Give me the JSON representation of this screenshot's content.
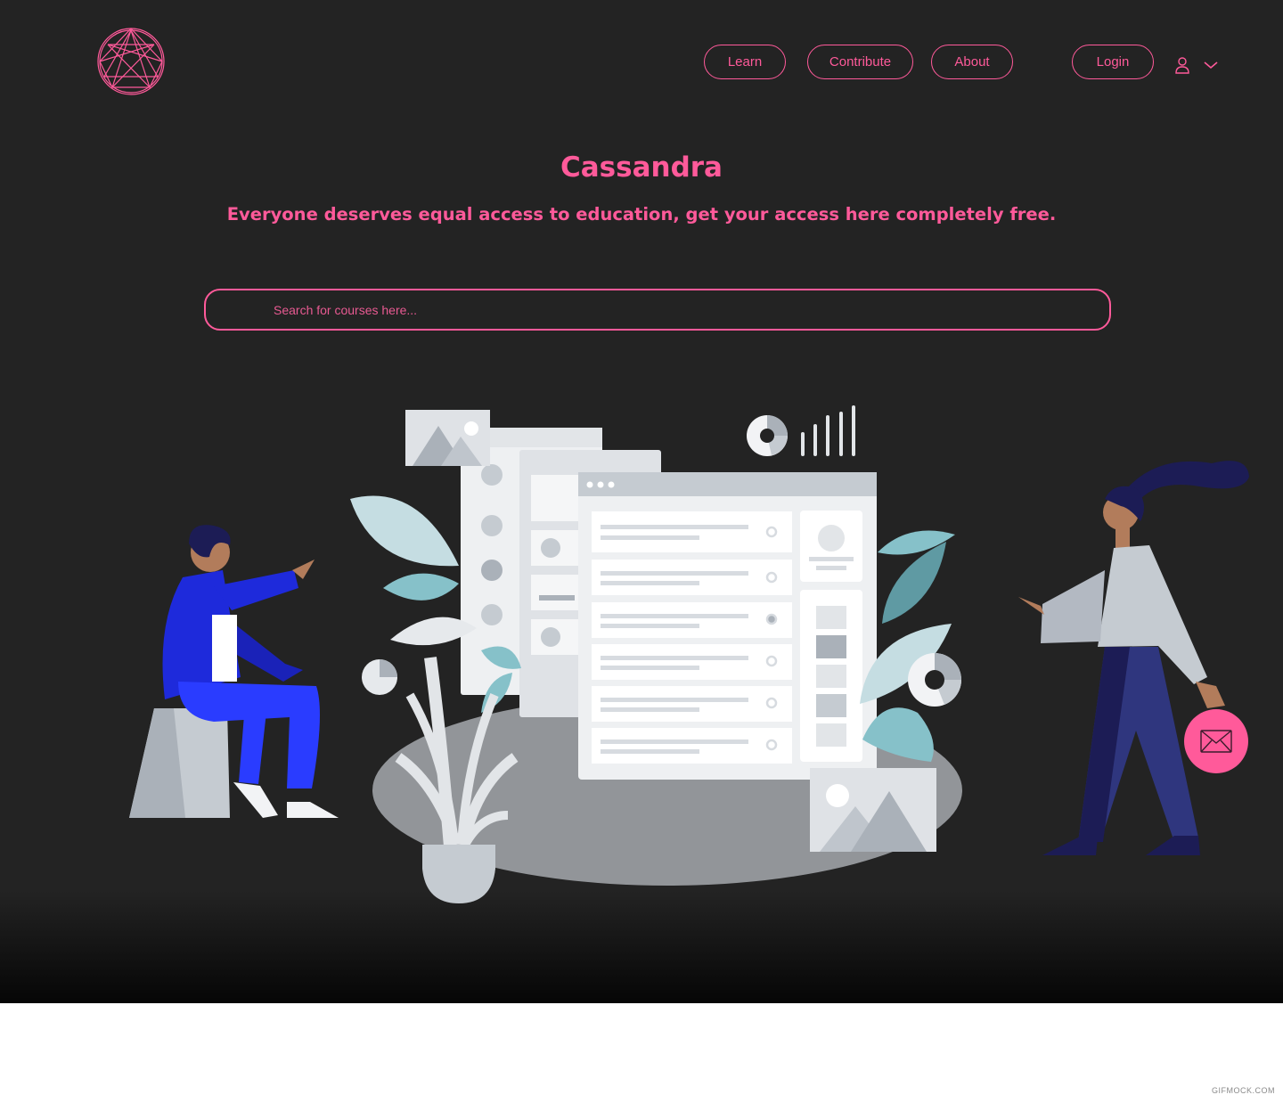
{
  "brand": {
    "logo_icon": "enneagram-logo-icon",
    "accent_color": "#ff5a9a"
  },
  "nav": {
    "learn": "Learn",
    "contribute": "Contribute",
    "about": "About",
    "login": "Login",
    "user_icon": "user-icon",
    "menu_icon": "chevron-down-icon"
  },
  "hero": {
    "title": "Cassandra",
    "subtitle": "Everyone deserves equal access to education, get your access here completely free."
  },
  "search": {
    "placeholder": "Search for courses here..."
  },
  "contact": {
    "icon": "mail-icon"
  },
  "footer": {
    "watermark": "GIFMOCK.COM"
  }
}
